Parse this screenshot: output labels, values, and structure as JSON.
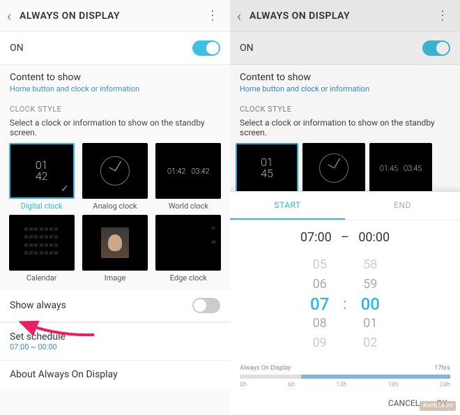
{
  "left": {
    "header": {
      "title": "ALWAYS ON DISPLAY"
    },
    "on_row": {
      "label": "ON"
    },
    "content": {
      "title": "Content to show",
      "sub": "Home button and clock or information"
    },
    "clock_style_label": "CLOCK STYLE",
    "desc": "Select a clock or information to show on the standby screen.",
    "tiles": {
      "digital": {
        "label": "Digital clock",
        "time": "01\n42"
      },
      "analog": {
        "label": "Analog clock"
      },
      "world": {
        "label": "World clock",
        "t1": "01:42",
        "t2": "03:42"
      },
      "calendar": {
        "label": "Calendar"
      },
      "image": {
        "label": "Image"
      },
      "edge": {
        "label": "Edge clock"
      }
    },
    "show_always": {
      "label": "Show always"
    },
    "schedule": {
      "label": "Set schedule",
      "sub": "07:00 ~ 00:00"
    },
    "about": {
      "label": "About Always On Display"
    }
  },
  "right": {
    "header": {
      "title": "ALWAYS ON DISPLAY"
    },
    "on_row": {
      "label": "ON"
    },
    "content": {
      "title": "Content to show",
      "sub": "Home button and clock or information"
    },
    "clock_style_label": "CLOCK STYLE",
    "desc": "Select a clock or information to show on the standby screen.",
    "strip": {
      "digital_time": "01\n45",
      "world_t1": "01:45",
      "world_t2": "03:45"
    },
    "tabs": {
      "start": "START",
      "end": "END"
    },
    "time_sel": {
      "start": "07:00",
      "dash": "–",
      "end": "00:00"
    },
    "hour_wheel": {
      "n2": "05",
      "n1": "06",
      "sel": "07",
      "p1": "08",
      "p2": "09"
    },
    "min_wheel": {
      "n2": "58",
      "n1": "59",
      "sel": "00",
      "p1": "01",
      "p2": "02"
    },
    "colon": ":",
    "timeline": {
      "label": "Always On Display",
      "duration": "17hrs",
      "ticks": [
        "0h",
        "6h",
        "12h",
        "18h",
        "24h"
      ]
    },
    "buttons": {
      "cancel": "CANCEL",
      "ok": "OK"
    },
    "watermark": "Kenh14.vn"
  }
}
